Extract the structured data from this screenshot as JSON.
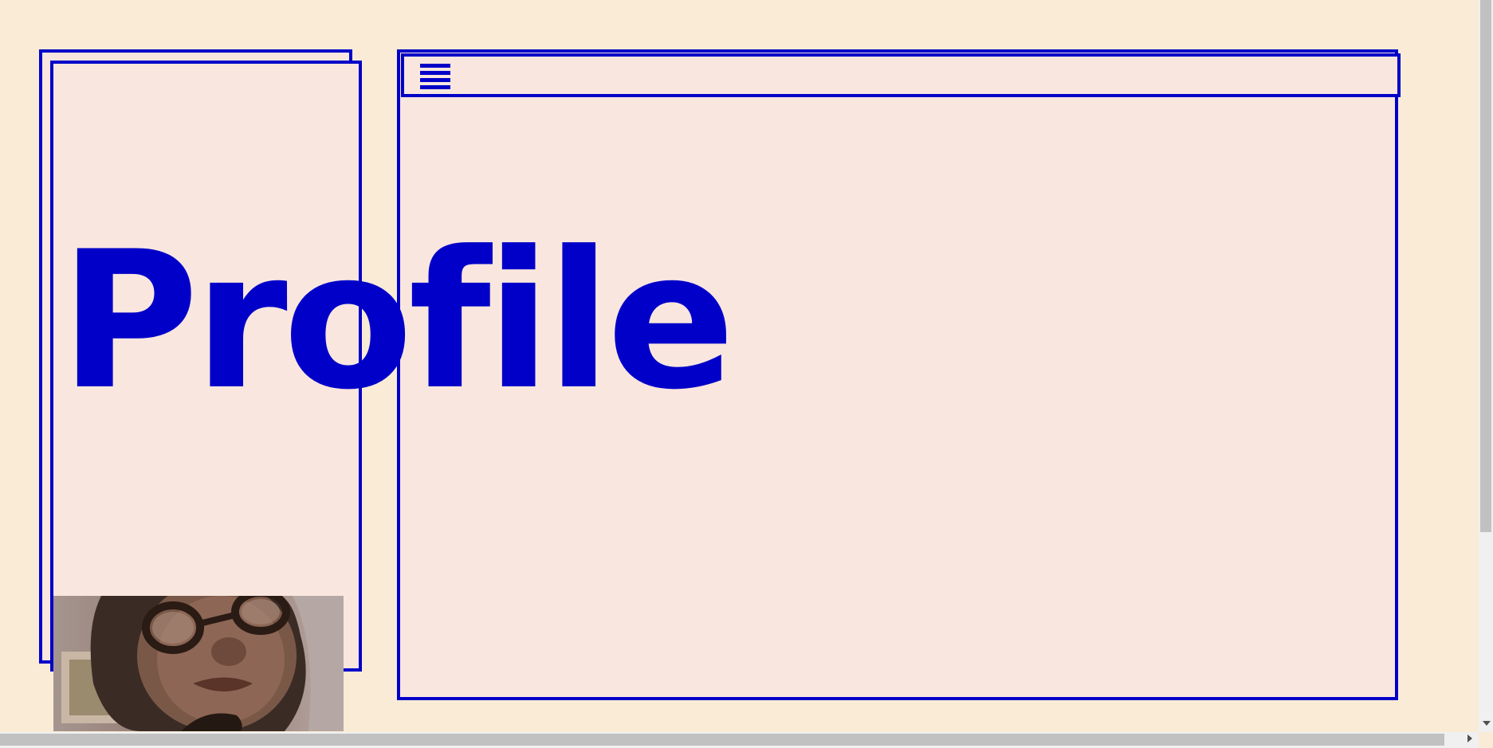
{
  "page": {
    "title": "Profile"
  },
  "colors": {
    "background": "#faebd7",
    "panel": "#f9e6df",
    "accent": "#0000c8"
  },
  "icons": {
    "menu": "hamburger-menu-icon",
    "avatar": "profile-photo"
  }
}
